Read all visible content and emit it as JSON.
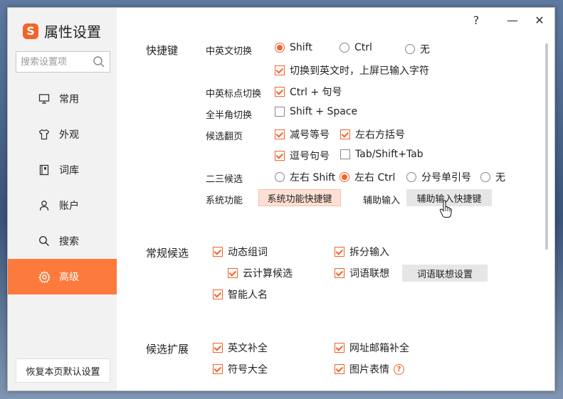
{
  "app": {
    "title": "属性设置"
  },
  "window_controls": {
    "help": "?",
    "minimize": "—",
    "close": "✕"
  },
  "sidebar": {
    "search_placeholder": "搜索设置项",
    "items": [
      {
        "label": "常用",
        "icon": "monitor-icon"
      },
      {
        "label": "外观",
        "icon": "shirt-icon"
      },
      {
        "label": "词库",
        "icon": "book-icon"
      },
      {
        "label": "账户",
        "icon": "user-icon"
      },
      {
        "label": "搜索",
        "icon": "search-icon"
      },
      {
        "label": "高级",
        "icon": "gear-icon",
        "active": true
      }
    ],
    "reset_label": "恢复本页默认设置"
  },
  "shortcuts": {
    "title": "快捷键",
    "cn_en": {
      "label": "中英文切换",
      "options": [
        "Shift",
        "Ctrl",
        "无"
      ],
      "selected": "Shift"
    },
    "cn_en_sub": {
      "label": "切换到英文时，上屏已输入字符",
      "checked": true
    },
    "punct": {
      "label": "中英标点切换",
      "option": "Ctrl + 句号",
      "checked": true
    },
    "fullhalf": {
      "label": "全半角切换",
      "option": "Shift + Space",
      "checked": false
    },
    "paging": {
      "label": "候选翻页",
      "options": [
        {
          "label": "减号等号",
          "checked": true
        },
        {
          "label": "左右方括号",
          "checked": true
        },
        {
          "label": "逗号句号",
          "checked": true
        },
        {
          "label": "Tab/Shift+Tab",
          "checked": false
        }
      ]
    },
    "two_three": {
      "label": "二三候选",
      "options": [
        "左右 Shift",
        "左右 Ctrl",
        "分号单引号",
        "无"
      ],
      "selected": "左右 Ctrl"
    },
    "system": {
      "label": "系统功能",
      "button": "系统功能快捷键"
    },
    "assist": {
      "label": "辅助输入",
      "button": "辅助输入快捷键"
    }
  },
  "candidates": {
    "title": "常规候选",
    "items": [
      {
        "label": "动态组词",
        "checked": true
      },
      {
        "label": "拆分输入",
        "checked": true
      },
      {
        "label": "云计算候选",
        "checked": true
      },
      {
        "label": "词语联想",
        "checked": true
      },
      {
        "label": "智能人名",
        "checked": true
      }
    ],
    "assoc_button": "词语联想设置"
  },
  "extension": {
    "title": "候选扩展",
    "items": [
      {
        "label": "英文补全",
        "checked": true
      },
      {
        "label": "网址邮箱补全",
        "checked": true
      },
      {
        "label": "符号大全",
        "checked": true
      },
      {
        "label": "图片表情",
        "checked": true
      }
    ]
  },
  "colors": {
    "accent": "#f2632b",
    "active_nav": "#fb7a3c"
  }
}
